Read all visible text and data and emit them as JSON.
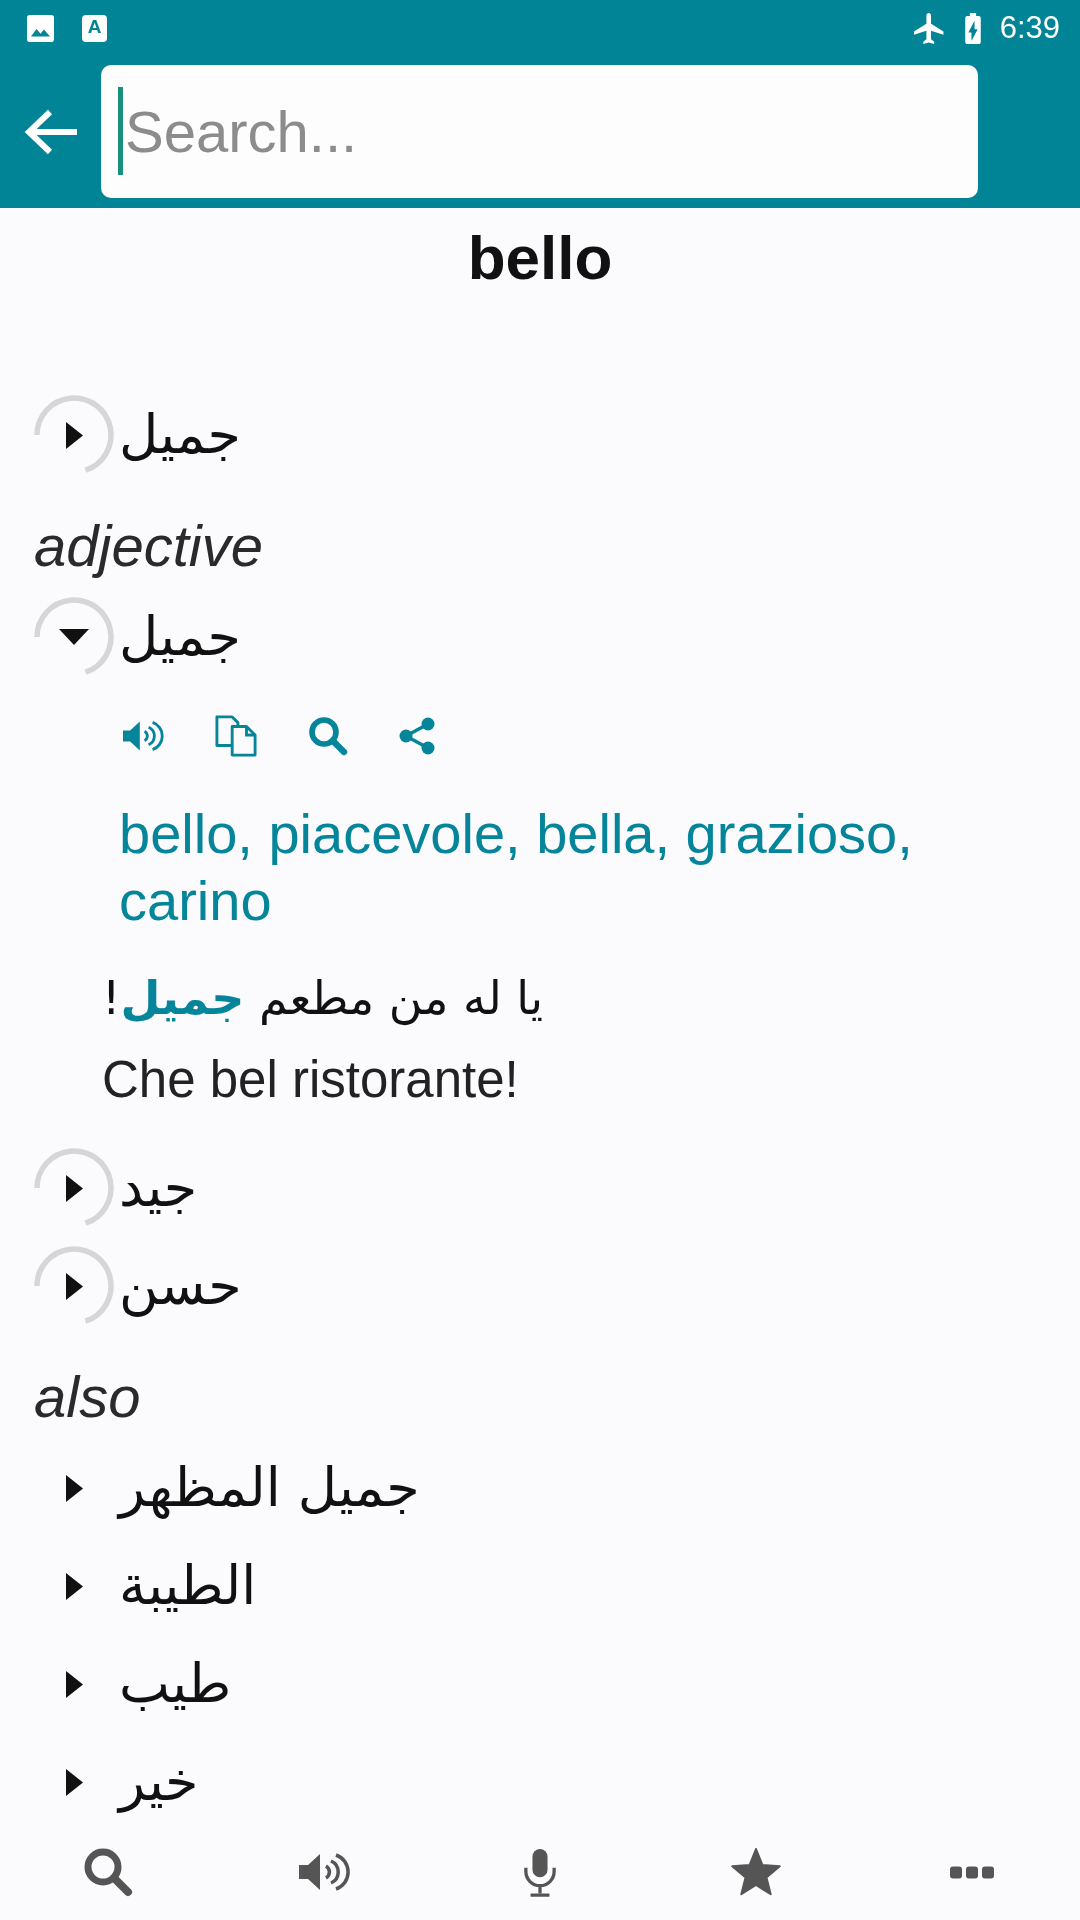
{
  "status_bar": {
    "notification_letter": "A",
    "time": "6:39"
  },
  "toolbar": {
    "search": {
      "placeholder": "Search..."
    }
  },
  "headword": "bello",
  "entries": [
    {
      "kind": "sense",
      "term": "جميل",
      "expanded": false,
      "loading": true
    },
    {
      "kind": "label",
      "text": "adjective"
    },
    {
      "kind": "sense",
      "term": "جميل",
      "expanded": true,
      "loading": true,
      "translations": "bello, piacevole, bella, grazioso, carino",
      "example": {
        "source": "يا له من مطعم **جميل**!",
        "target": "Che bel ristorante!"
      }
    },
    {
      "kind": "sense",
      "term": "جيد",
      "expanded": false,
      "loading": true
    },
    {
      "kind": "sense",
      "term": "حسن",
      "expanded": false,
      "loading": true
    },
    {
      "kind": "label",
      "text": "also"
    },
    {
      "kind": "sense",
      "term": "جميل المظهر",
      "expanded": false,
      "loading": false
    },
    {
      "kind": "sense",
      "term": "الطيبة",
      "expanded": false,
      "loading": false
    },
    {
      "kind": "sense",
      "term": "طيب",
      "expanded": false,
      "loading": false
    },
    {
      "kind": "sense",
      "term": "خير",
      "expanded": false,
      "loading": false
    }
  ]
}
